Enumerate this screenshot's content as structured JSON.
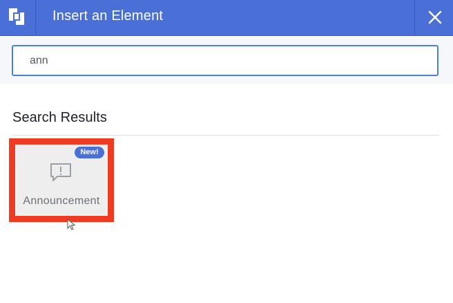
{
  "header": {
    "title": "Insert an Element",
    "logo_icon": "logo-icon",
    "close_icon": "close-icon",
    "background": "#4a6fd6"
  },
  "search": {
    "value": "ann",
    "placeholder": ""
  },
  "results": {
    "heading": "Search Results",
    "items": [
      {
        "label": "Announcement",
        "badge": "New!",
        "icon": "announcement-icon",
        "highlighted": true,
        "highlight_color": "#ee3b22"
      }
    ]
  }
}
